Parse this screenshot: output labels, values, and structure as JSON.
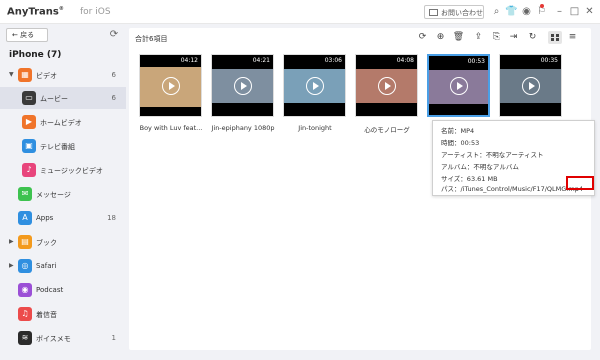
{
  "titlebar": {
    "app_name": "AnyTrans",
    "registered": "®",
    "app_sub": "for iOS",
    "contact_label": "お問い合わせ"
  },
  "sidebar": {
    "back_label": "← 戻る",
    "device_name": "iPhone (7)",
    "items": [
      {
        "label": "ビデオ",
        "count": "6",
        "icon": "video-category-icon",
        "color": "#f0742a"
      },
      {
        "label": "ムービー",
        "count": "6",
        "icon": "movie-icon",
        "color": "#3a3a3a"
      },
      {
        "label": "ホームビデオ",
        "count": "",
        "icon": "home-video-icon",
        "color": "#f0742a"
      },
      {
        "label": "テレビ番組",
        "count": "",
        "icon": "tv-show-icon",
        "color": "#2f8fe0"
      },
      {
        "label": "ミュージックビデオ",
        "count": "",
        "icon": "music-video-icon",
        "color": "#e8457c"
      },
      {
        "label": "メッセージ",
        "count": "",
        "icon": "messages-icon",
        "color": "#3dc24f"
      },
      {
        "label": "Apps",
        "count": "18",
        "icon": "apps-icon",
        "color": "#2f8fe0"
      },
      {
        "label": "ブック",
        "count": "",
        "icon": "book-icon",
        "color": "#f39a1d"
      },
      {
        "label": "Safari",
        "count": "",
        "icon": "safari-icon",
        "color": "#2f8fe0"
      },
      {
        "label": "Podcast",
        "count": "",
        "icon": "podcast-icon",
        "color": "#9b4fd6"
      },
      {
        "label": "着信音",
        "count": "",
        "icon": "ringtone-icon",
        "color": "#ec4b4b"
      },
      {
        "label": "ボイスメモ",
        "count": "1",
        "icon": "voice-memo-icon",
        "color": "#2b2b2b"
      }
    ]
  },
  "main": {
    "count_label": "合計6項目",
    "videos": [
      {
        "title": "Boy with Luv feat...",
        "duration": "04:12",
        "scene": "#c9a67a"
      },
      {
        "title": "Jin-epiphany 1080p",
        "duration": "04:21",
        "scene": "#7e8fa0"
      },
      {
        "title": "Jin-tonight",
        "duration": "03:06",
        "scene": "#7aa0b8"
      },
      {
        "title": "心のモノローグ",
        "duration": "04:08",
        "scene": "#b47a6a"
      },
      {
        "title": "",
        "duration": "00:53",
        "scene": "#8a7a9a"
      },
      {
        "title": "",
        "duration": "00:35",
        "scene": "#6a7a88"
      }
    ]
  },
  "tooltip": {
    "name": "名前：MP4",
    "time": "時間：00:53",
    "artist": "アーティスト：不明なアーティスト",
    "album": "アルバム：不明なアルバム",
    "size": "サイズ：63.61 MB",
    "path": "パス：/iTunes_Control/Music/F17/QLMG.mp4"
  }
}
